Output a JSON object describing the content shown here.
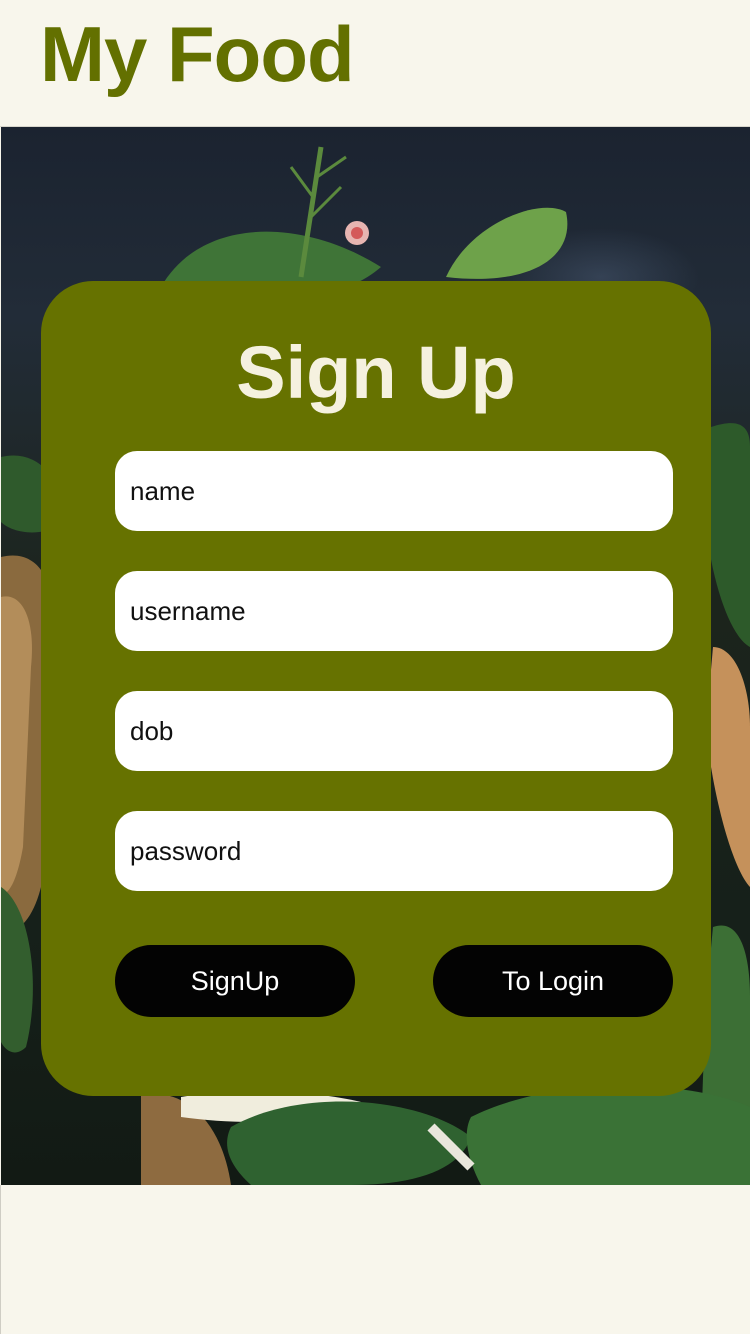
{
  "app": {
    "brand": "My Food",
    "colors": {
      "brand_green": "#637000",
      "card_green": "#667200",
      "background": "#f8f6ec",
      "button": "#030303"
    }
  },
  "hero": {
    "image": "food-photo-spinach-toast-egg"
  },
  "signup": {
    "title": "Sign Up",
    "fields": {
      "name": {
        "placeholder": "name",
        "value": ""
      },
      "username": {
        "placeholder": "username",
        "value": ""
      },
      "dob": {
        "placeholder": "dob",
        "value": ""
      },
      "password": {
        "placeholder": "password",
        "value": ""
      }
    },
    "buttons": {
      "signup": "SignUp",
      "to_login": "To Login"
    }
  }
}
